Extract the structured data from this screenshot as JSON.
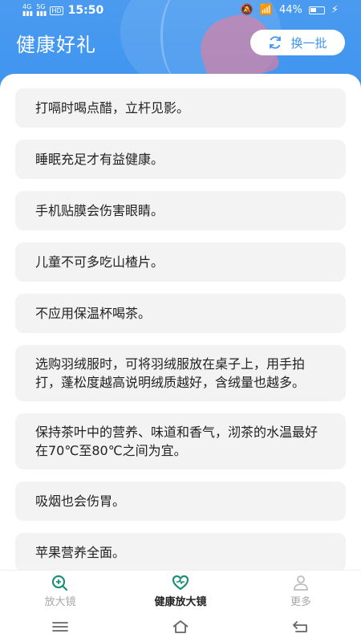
{
  "status_bar": {
    "net1": "4G",
    "net2": "5G",
    "hd": "HD",
    "time": "15:50",
    "battery": "44%"
  },
  "header": {
    "title": "健康好礼",
    "refresh_label": "换一批"
  },
  "tips": [
    "打嗝时喝点醋，立杆见影。",
    "睡眠充足才有益健康。",
    "手机贴膜会伤害眼睛。",
    "儿童不可多吃山楂片。",
    "不应用保温杯喝茶。",
    "选购羽绒服时，可将羽绒服放在桌子上，用手拍打，蓬松度越高说明绒质越好，含绒量也越多。",
    "保持茶叶中的营养、味道和香气，沏茶的水温最好在70℃至80℃之间为宜。",
    "吸烟也会伤胃。",
    "苹果营养全面。"
  ],
  "bottom_nav": [
    {
      "label": "放大镜",
      "icon": "magnifier-icon"
    },
    {
      "label": "健康放大镜",
      "icon": "heart-icon"
    },
    {
      "label": "更多",
      "icon": "person-icon"
    }
  ],
  "colors": {
    "accent": "#3f94ee",
    "card_bg": "#f3f3f3"
  }
}
